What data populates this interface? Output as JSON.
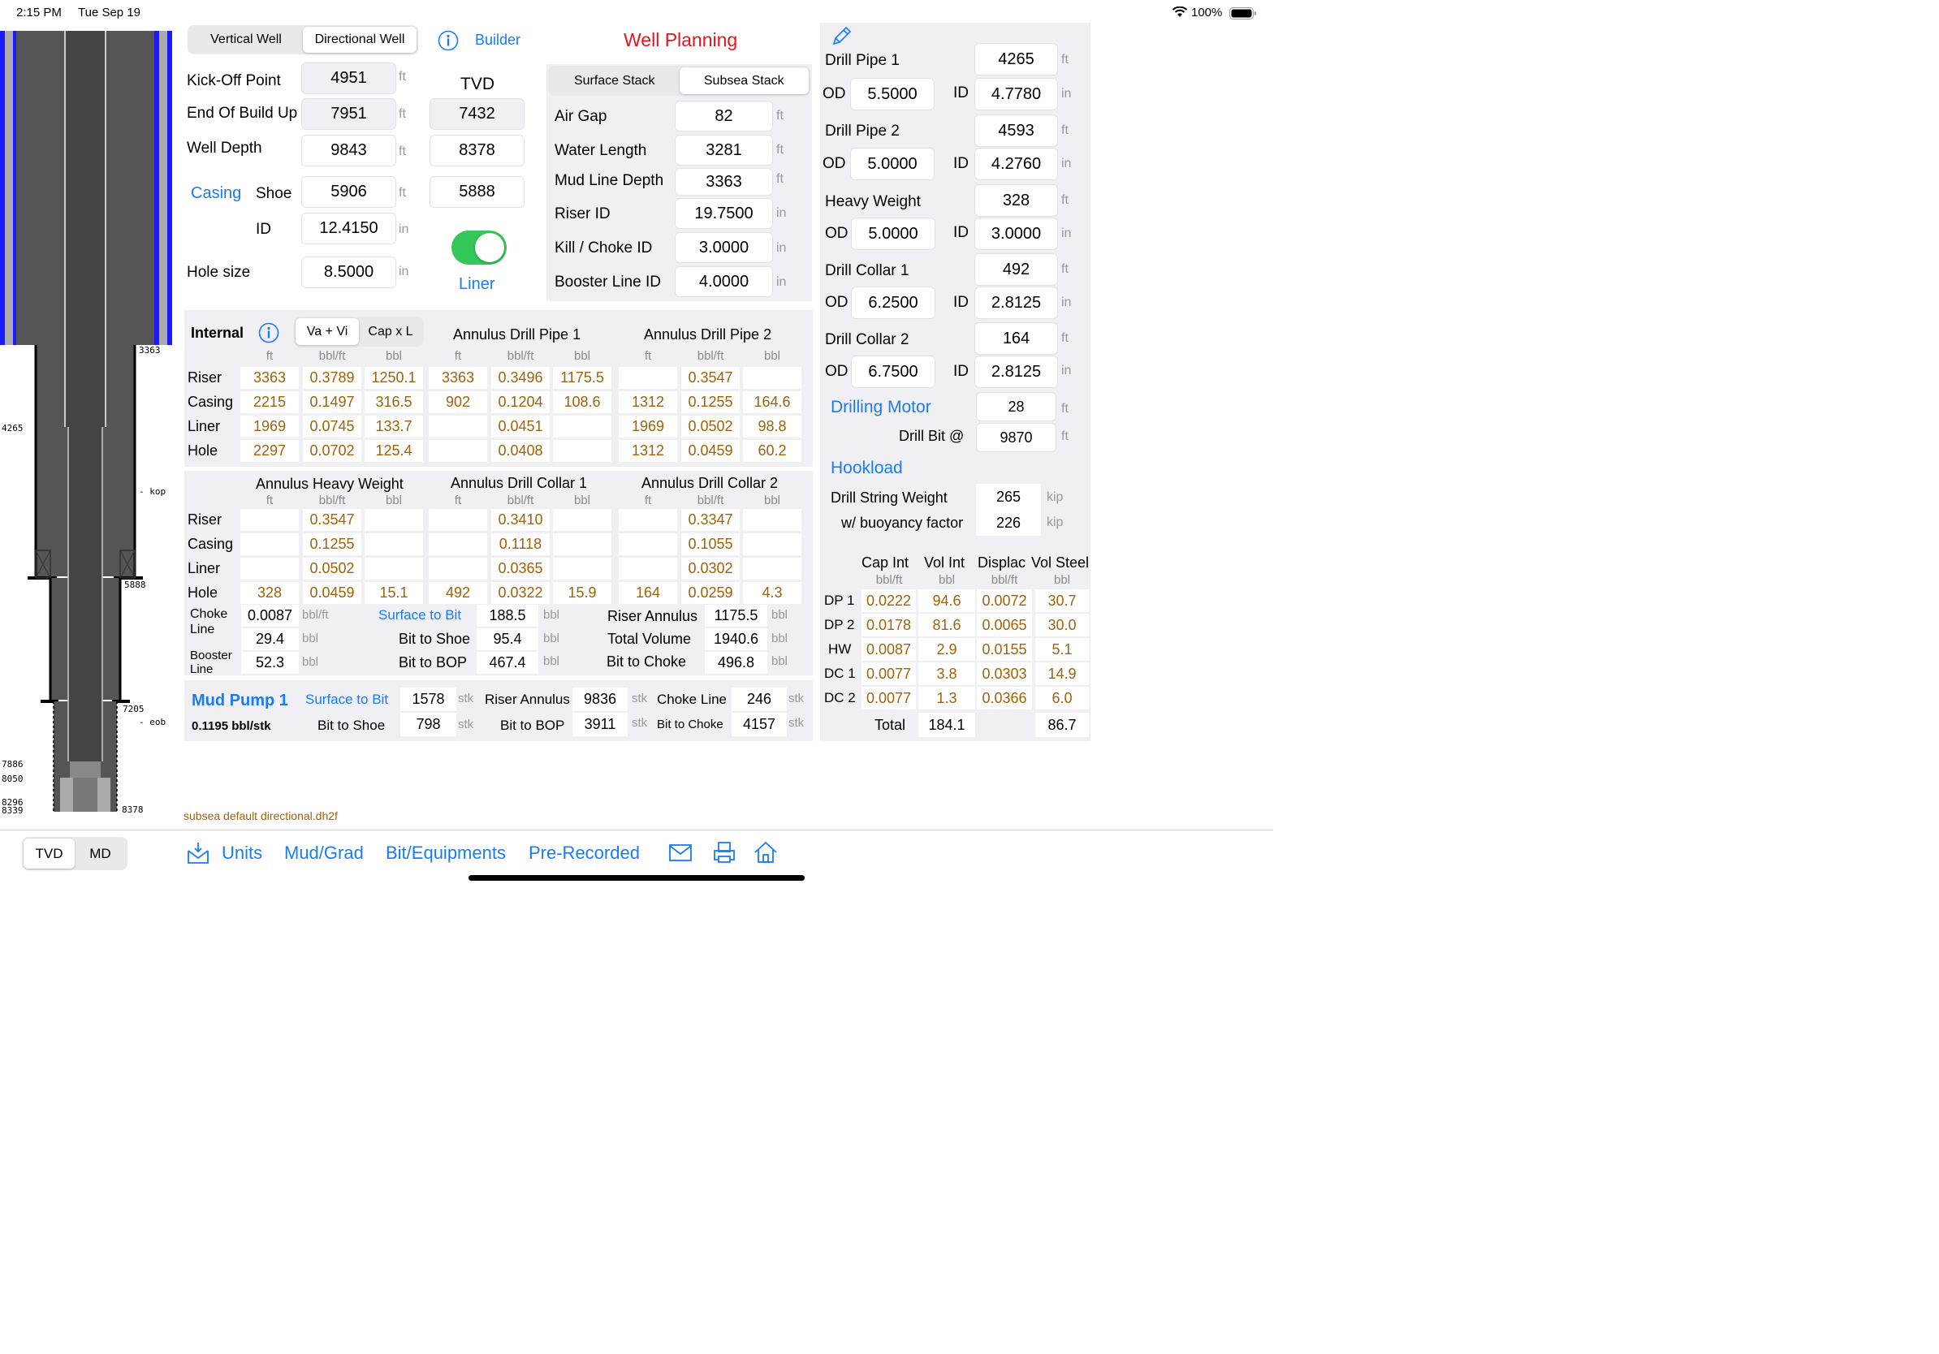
{
  "status": {
    "time": "2:15 PM",
    "date": "Tue Sep 19",
    "battery": "100%"
  },
  "well_type": {
    "options": [
      "Vertical Well",
      "Directional Well"
    ],
    "selected": "Directional Well"
  },
  "builder_label": "Builder",
  "title": "Well Planning",
  "tvd_header": "TVD",
  "liner_label": "Liner",
  "liner_on": true,
  "casing_label": "Casing",
  "geometry": [
    {
      "label": "Kick-Off Point",
      "value": "4951",
      "unit": "ft"
    },
    {
      "label": "End Of Build Up",
      "value": "7951",
      "unit": "ft",
      "tvd": "7432"
    },
    {
      "label": "Well Depth",
      "value": "9843",
      "unit": "ft",
      "tvd": "8378"
    },
    {
      "label": "Shoe",
      "value": "5906",
      "unit": "ft",
      "tvd": "5888"
    },
    {
      "label": "ID",
      "value": "12.4150",
      "unit": "in"
    },
    {
      "label": "Hole size",
      "value": "8.5000",
      "unit": "in"
    }
  ],
  "stack": {
    "options": [
      "Surface Stack",
      "Subsea Stack"
    ],
    "selected": "Subsea Stack",
    "rows": [
      {
        "label": "Air Gap",
        "value": "82",
        "unit": "ft"
      },
      {
        "label": "Water Length",
        "value": "3281",
        "unit": "ft"
      },
      {
        "label": "Mud Line Depth",
        "value": "3363",
        "unit": "ft"
      },
      {
        "label": "Riser ID",
        "value": "19.7500",
        "unit": "in"
      },
      {
        "label": "Kill / Choke ID",
        "value": "3.0000",
        "unit": "in"
      },
      {
        "label": "Booster Line ID",
        "value": "4.0000",
        "unit": "in"
      }
    ]
  },
  "string": [
    {
      "label": "Drill Pipe 1",
      "length": "4265",
      "od": "5.5000",
      "id": "4.7780"
    },
    {
      "label": "Drill Pipe 2",
      "length": "4593",
      "od": "5.0000",
      "id": "4.2760"
    },
    {
      "label": "Heavy Weight",
      "length": "328",
      "od": "5.0000",
      "id": "3.0000"
    },
    {
      "label": "Drill Collar 1",
      "length": "492",
      "od": "6.2500",
      "id": "2.8125"
    },
    {
      "label": "Drill Collar 2",
      "length": "164",
      "od": "6.7500",
      "id": "2.8125"
    }
  ],
  "string_labels": {
    "od": "OD",
    "id": "ID",
    "ft": "ft",
    "in": "in"
  },
  "motor": {
    "label": "Drilling Motor",
    "value": "28",
    "unit": "ft"
  },
  "bit": {
    "label": "Drill Bit @",
    "value": "9870",
    "unit": "ft"
  },
  "hookload": {
    "title": "Hookload",
    "rows": [
      {
        "label": "Drill String Weight",
        "value": "265",
        "unit": "kip"
      },
      {
        "label": "w/ buoyancy factor",
        "value": "226",
        "unit": "kip"
      }
    ]
  },
  "vol_table": {
    "headers": [
      "Cap Int",
      "Vol Int",
      "Displac",
      "Vol Steel"
    ],
    "units": [
      "bbl/ft",
      "bbl",
      "bbl/ft",
      "bbl"
    ],
    "rows": [
      {
        "label": "DP 1",
        "values": [
          "0.0222",
          "94.6",
          "0.0072",
          "30.7"
        ]
      },
      {
        "label": "DP 2",
        "values": [
          "0.0178",
          "81.6",
          "0.0065",
          "30.0"
        ]
      },
      {
        "label": "HW",
        "values": [
          "0.0087",
          "2.9",
          "0.0155",
          "5.1"
        ]
      },
      {
        "label": "DC 1",
        "values": [
          "0.0077",
          "3.8",
          "0.0303",
          "14.9"
        ]
      },
      {
        "label": "DC 2",
        "values": [
          "0.0077",
          "1.3",
          "0.0366",
          "6.0"
        ]
      }
    ],
    "total_label": "Total",
    "total_vol_int": "184.1",
    "total_vol_steel": "86.7"
  },
  "internal": {
    "title": "Internal",
    "modes": [
      "Va + Vi",
      "Cap x L"
    ],
    "selected": "Va + Vi"
  },
  "group_headers_1": [
    "Annulus Drill Pipe 1",
    "Annulus Drill Pipe 2"
  ],
  "group_headers_2": [
    "Annulus Heavy Weight",
    "Annulus Drill Collar 1",
    "Annulus Drill Collar 2"
  ],
  "col_units": [
    "ft",
    "bbl/ft",
    "bbl"
  ],
  "row_labels": [
    "Riser",
    "Casing",
    "Liner",
    "Hole"
  ],
  "table1": [
    [
      "3363",
      "0.3789",
      "1250.1",
      "3363",
      "0.3496",
      "1175.5",
      "",
      "0.3547",
      ""
    ],
    [
      "2215",
      "0.1497",
      "316.5",
      "902",
      "0.1204",
      "108.6",
      "1312",
      "0.1255",
      "164.6"
    ],
    [
      "1969",
      "0.0745",
      "133.7",
      "",
      "0.0451",
      "",
      "1969",
      "0.0502",
      "98.8"
    ],
    [
      "2297",
      "0.0702",
      "125.4",
      "",
      "0.0408",
      "",
      "1312",
      "0.0459",
      "60.2"
    ]
  ],
  "table2": [
    [
      "",
      "0.3547",
      "",
      "",
      "0.3410",
      "",
      "",
      "0.3347",
      ""
    ],
    [
      "",
      "0.1255",
      "",
      "",
      "0.1118",
      "",
      "",
      "0.1055",
      ""
    ],
    [
      "",
      "0.0502",
      "",
      "",
      "0.0365",
      "",
      "",
      "0.0302",
      ""
    ],
    [
      "328",
      "0.0459",
      "15.1",
      "492",
      "0.0322",
      "15.9",
      "164",
      "0.0259",
      "4.3"
    ]
  ],
  "lines": {
    "choke_label": "Choke Line",
    "choke_cap": "0.0087",
    "choke_cap_unit": "bbl/ft",
    "choke_vol": "29.4",
    "choke_vol_unit": "bbl",
    "booster_label": "Booster Line",
    "booster_vol": "52.3",
    "booster_vol_unit": "bbl",
    "surface_to_bit_label": "Surface to Bit",
    "surface_to_bit": "188.5",
    "bit_to_shoe_label": "Bit to Shoe",
    "bit_to_shoe": "95.4",
    "bit_to_bop_label": "Bit to BOP",
    "bit_to_bop": "467.4",
    "riser_annulus_label": "Riser Annulus",
    "riser_annulus": "1175.5",
    "total_volume_label": "Total Volume",
    "total_volume": "1940.6",
    "bit_to_choke_label": "Bit to Choke",
    "bit_to_choke": "496.8",
    "unit": "bbl"
  },
  "pump": {
    "title": "Mud Pump 1",
    "rate": "0.1195 bbl/stk",
    "unit": "stk",
    "surface_to_bit_label": "Surface to Bit",
    "surface_to_bit": "1578",
    "riser_annulus_label": "Riser Annulus",
    "riser_annulus": "9836",
    "choke_line_label": "Choke Line",
    "choke_line": "246",
    "bit_to_shoe_label": "Bit to Shoe",
    "bit_to_shoe": "798",
    "bit_to_bop_label": "Bit to BOP",
    "bit_to_bop": "3911",
    "bit_to_choke_label": "Bit to Choke",
    "bit_to_choke": "4157"
  },
  "filename": "subsea default directional.dh2f",
  "depth_labels": {
    "d3363": "3363",
    "d4265": "4265",
    "kop": "- kop",
    "d5888": "5888",
    "d7205": "7205",
    "eob": "- eob",
    "d7886": "7886",
    "d8050": "8050",
    "d8296": "8296",
    "d8339": "8339",
    "d8378": "8378"
  },
  "mode_toggle": {
    "options": [
      "TVD",
      "MD"
    ],
    "selected": "TVD"
  },
  "toolbar": {
    "units": "Units",
    "mud": "Mud/Grad",
    "bit": "Bit/Equipments",
    "pre": "Pre-Recorded"
  },
  "colors": {
    "accent": "#1a7cf5",
    "title": "#e8141a",
    "value": "#a0620a",
    "riser": "#1a1aff",
    "toggle": "#34c759"
  }
}
